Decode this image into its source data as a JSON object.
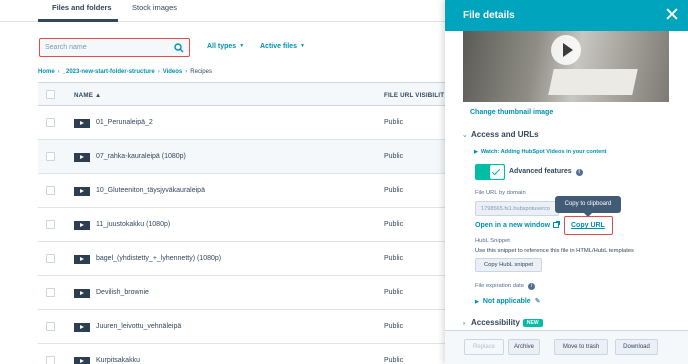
{
  "tabs": {
    "files": "Files and folders",
    "stock": "Stock images"
  },
  "search": {
    "placeholder": "Search name"
  },
  "filters": {
    "types": "All types",
    "active": "Active files"
  },
  "breadcrumb": {
    "home": "Home",
    "folder1": "_2023-new-start-folder-structure",
    "folder2": "Videos",
    "current": "Recipes"
  },
  "table": {
    "headers": {
      "name": "NAME",
      "visibility": "FILE URL VISIBILIT"
    },
    "rows": [
      {
        "name": "01_Perunaleipä_2",
        "visibility": "Public"
      },
      {
        "name": "07_rahka-kauraleipä (1080p)",
        "visibility": "Public"
      },
      {
        "name": "10_Gluteeniton_täysjyväkauraleipä",
        "visibility": "Public"
      },
      {
        "name": "11_juustokakku (1080p)",
        "visibility": "Public"
      },
      {
        "name": "bagel_(yhdistetty_+_lyhennetty) (1080p)",
        "visibility": "Public"
      },
      {
        "name": "Devilish_brownie",
        "visibility": "Public"
      },
      {
        "name": "Juuren_leivottu_vehnäleipä",
        "visibility": "Public"
      },
      {
        "name": "Kurpitsakakku",
        "visibility": "Public"
      }
    ]
  },
  "panel": {
    "title": "File details",
    "change_thumbnail": "Change thumbnail image",
    "access_section": "Access and URLs",
    "watch_link": "Watch: Adding HubSpot Videos in your content",
    "advanced_features": "Advanced features",
    "url_by_domain_label": "File URL by domain",
    "url_value": "1798565.fs1.hubspotuserco",
    "tooltip": "Copy to clipboard",
    "open_window": "Open in a new window",
    "copy_url": "Copy URL",
    "hubl_label": "HubL Snippet",
    "hubl_desc": "Use this snippet to reference this file in HTML/HubL templates",
    "copy_hubl": "Copy HubL snippet",
    "expiration_label": "File expiration date",
    "not_applicable": "Not applicable",
    "accessibility_section": "Accessibility",
    "badge": "NEW",
    "footer": {
      "replace": "Replace",
      "archive": "Archive",
      "trash": "Move to trash",
      "download": "Download"
    }
  },
  "colors": {
    "accent": "#00a4bd",
    "link": "#0091ae",
    "toggle": "#00bda5",
    "highlight": "#e04c4c"
  }
}
